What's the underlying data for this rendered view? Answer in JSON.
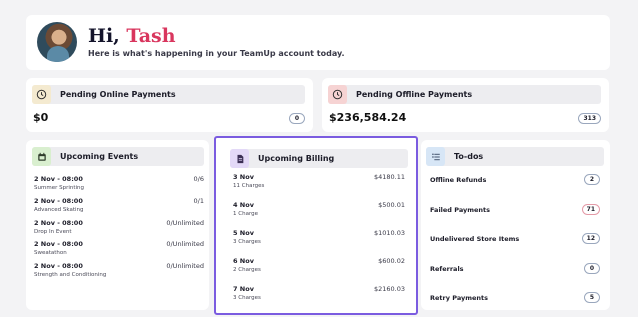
{
  "greeting": {
    "prefix": "Hi,",
    "name": "Tash",
    "subtitle": "Here is what's happening in your TeamUp account today."
  },
  "online_payments": {
    "title": "Pending Online Payments",
    "amount": "$0",
    "count": "0",
    "icon": "clock-icon",
    "icon_bg": "#f4ead0"
  },
  "offline_payments": {
    "title": "Pending Offline Payments",
    "amount": "$236,584.24",
    "count": "313",
    "icon": "clock-icon",
    "icon_bg": "#f6d3d3"
  },
  "events": {
    "title": "Upcoming Events",
    "icon": "calendar-icon",
    "icon_bg": "#d9efcf",
    "items": [
      {
        "when": "2 Nov - 08:00",
        "name": "Summer Sprinting",
        "capacity": "0/6"
      },
      {
        "when": "2 Nov - 08:00",
        "name": "Advanced Skating",
        "capacity": "0/1"
      },
      {
        "when": "2 Nov - 08:00",
        "name": "Drop In Event",
        "capacity": "0/Unlimited"
      },
      {
        "when": "2 Nov - 08:00",
        "name": "Sweatathon",
        "capacity": "0/Unlimited"
      },
      {
        "when": "2 Nov - 08:00",
        "name": "Strength and Conditioning",
        "capacity": "0/Unlimited"
      }
    ]
  },
  "billing": {
    "title": "Upcoming Billing",
    "icon": "invoice-icon",
    "icon_bg": "#e3d9f7",
    "items": [
      {
        "date": "3 Nov",
        "charges": "11 Charges",
        "amount": "$4180.11"
      },
      {
        "date": "4 Nov",
        "charges": "1 Charge",
        "amount": "$500.01"
      },
      {
        "date": "5 Nov",
        "charges": "3 Charges",
        "amount": "$1010.03"
      },
      {
        "date": "6 Nov",
        "charges": "2 Charges",
        "amount": "$600.02"
      },
      {
        "date": "7 Nov",
        "charges": "3 Charges",
        "amount": "$2160.03"
      }
    ]
  },
  "todos": {
    "title": "To-dos",
    "icon": "checklist-icon",
    "icon_bg": "#d7e6f6",
    "items": [
      {
        "label": "Offline Refunds",
        "count": "2"
      },
      {
        "label": "Failed Payments",
        "count": "71"
      },
      {
        "label": "Undelivered Store Items",
        "count": "12"
      },
      {
        "label": "Referrals",
        "count": "0"
      },
      {
        "label": "Retry Payments",
        "count": "5"
      }
    ]
  }
}
